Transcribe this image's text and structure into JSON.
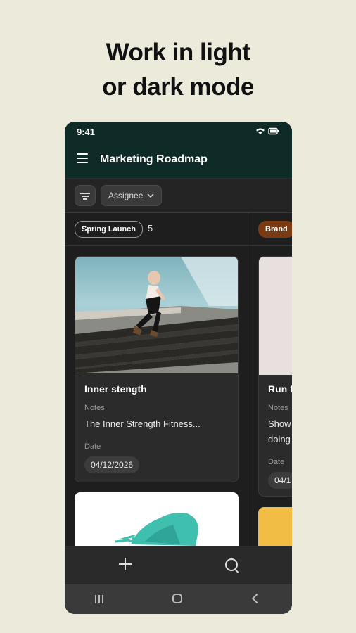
{
  "headline": {
    "line1": "Work in light",
    "line2": "or dark mode"
  },
  "status_bar": {
    "time": "9:41"
  },
  "app": {
    "title": "Marketing Roadmap"
  },
  "filters": {
    "assignee_label": "Assignee"
  },
  "groups": [
    {
      "name": "Spring Launch",
      "count": "5"
    },
    {
      "name": "Brand"
    }
  ],
  "cards": [
    {
      "title": "Inner stength",
      "notes_label": "Notes",
      "notes": "The Inner Strength Fitness...",
      "date_label": "Date",
      "date": "04/12/2026"
    },
    {
      "title": "Run f",
      "notes_label": "Notes",
      "notes_line1": "Show",
      "notes_line2": "doing",
      "date_label": "Date",
      "date": "04/1"
    }
  ],
  "colors": {
    "page_bg": "#ebeadb",
    "app_bar": "#0f2b27",
    "brand_chip": "#7a3b12",
    "accent_yellow": "#f1bd45"
  }
}
